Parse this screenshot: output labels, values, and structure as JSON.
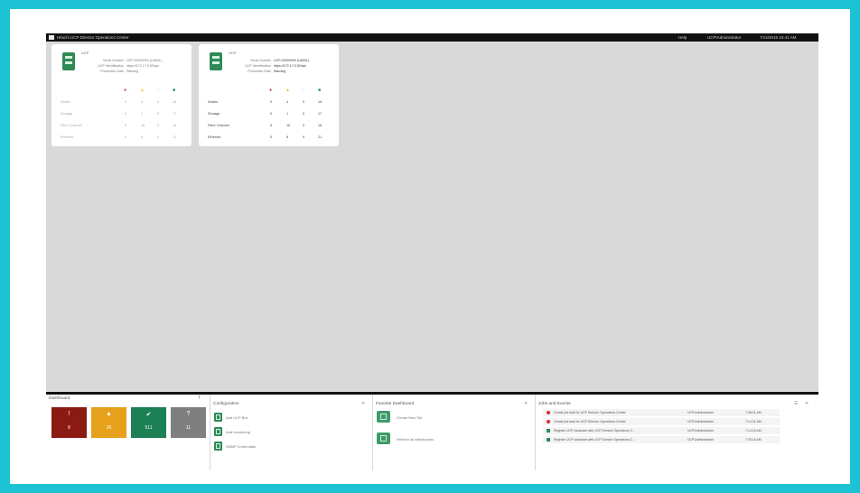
{
  "app": {
    "title": "Hitachi UCP Director Operations Center"
  },
  "topbar": {
    "item1": "Help",
    "item2": "UCP\\Administrator",
    "item3": "7/14/2015 10:41 AM"
  },
  "cards": [
    {
      "name": "UCP",
      "props": [
        {
          "key": "Serial Number",
          "value": "UCP-00000000 (LAB01)"
        },
        {
          "key": "UCP Identification",
          "value": "https://172.17.0.50/api"
        },
        {
          "key": "Production Date",
          "value": "Warning"
        }
      ],
      "rows": [
        {
          "label": "Nodes",
          "c": [
            "0",
            "4",
            "0",
            "16"
          ]
        },
        {
          "label": "Storage",
          "c": [
            "0",
            "1",
            "0",
            "17"
          ]
        },
        {
          "label": "Fibre Channel",
          "c": [
            "0",
            "16",
            "0",
            "16"
          ]
        },
        {
          "label": "Ethernet",
          "c": [
            "0",
            "8",
            "0",
            "21"
          ]
        }
      ]
    },
    {
      "name": "UCP",
      "props": [
        {
          "key": "Serial Number",
          "value": "UCP-00000000 (LAB01)"
        },
        {
          "key": "UCP Identification",
          "value": "https://172.17.0.50/api"
        },
        {
          "key": "Production Date",
          "value": "Warning"
        }
      ],
      "rows": [
        {
          "label": "Nodes",
          "c": [
            "0",
            "4",
            "0",
            "16"
          ]
        },
        {
          "label": "Storage",
          "c": [
            "0",
            "1",
            "0",
            "17"
          ]
        },
        {
          "label": "Fibre Channel",
          "c": [
            "0",
            "16",
            "0",
            "16"
          ]
        },
        {
          "label": "Ethernet",
          "c": [
            "0",
            "8",
            "0",
            "21"
          ]
        }
      ]
    }
  ],
  "dashboard": {
    "title": "Dashboard",
    "tiles": [
      {
        "icon": "!",
        "count": "8",
        "color": "#8b1a13"
      },
      {
        "icon": "▲",
        "count": "26",
        "color": "#e6a01b"
      },
      {
        "icon": "✔",
        "count": "511",
        "color": "#1c7f55"
      },
      {
        "icon": "?",
        "count": "11",
        "color": "#7f7f7f"
      }
    ]
  },
  "configuration": {
    "title": "Configuration",
    "items": [
      "Add UCP Box",
      "Add monitoring",
      "SNMP Credentials"
    ]
  },
  "frequent": {
    "title": "Favorite Dashboard",
    "items": [
      "Create New Tile",
      "Refresh all dashboards"
    ]
  },
  "jobs": {
    "title": "Jobs and Events",
    "rows": [
      {
        "status": "error",
        "desc": "Create job task for UCP Director Operations Center",
        "user": "UCP\\Administrator",
        "time": "7:48:31 AM"
      },
      {
        "status": "error",
        "desc": "Create job task for UCP Director Operations Center",
        "user": "UCP\\Administrator",
        "time": "7:14:31 AM"
      },
      {
        "status": "ok",
        "desc": "Register UCP hardware with UCP Director Operations C...",
        "user": "UCP\\Administrator",
        "time": "7:14:16 AM"
      },
      {
        "status": "ok",
        "desc": "Register UCP hardware with UCP Director Operations C...",
        "user": "UCP\\Administrator",
        "time": "7:03:16 AM"
      }
    ]
  },
  "colors": {
    "accent_frame": "#1cc3d4",
    "critical": "#d32f2f",
    "warning": "#f5c518",
    "ok": "#2f8a57"
  }
}
